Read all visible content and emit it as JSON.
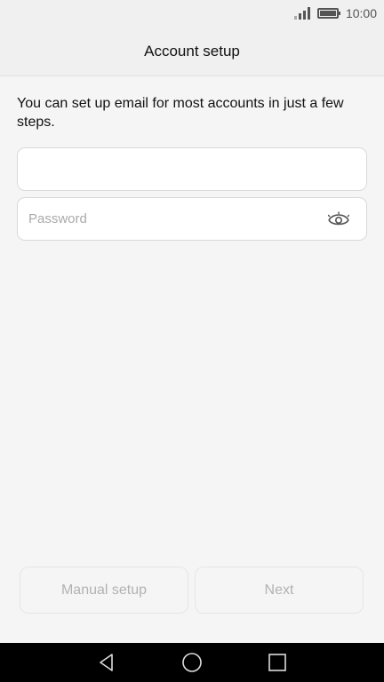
{
  "status_bar": {
    "time": "10:00",
    "icons": [
      "signal-icon",
      "battery-icon"
    ]
  },
  "header": {
    "title": "Account setup"
  },
  "intro_text": "You can set up email for most accounts in just a few steps.",
  "form": {
    "email": {
      "value": "",
      "placeholder": ""
    },
    "password": {
      "value": "",
      "placeholder": "Password"
    },
    "visibility_icon": "eye-icon"
  },
  "buttons": {
    "manual_setup": "Manual setup",
    "next": "Next"
  },
  "nav_bar": {
    "icons": [
      "back-icon",
      "home-icon",
      "recents-icon"
    ]
  },
  "colors": {
    "background": "#f5f5f5",
    "disabled_text": "#b2b2b2",
    "nav_bar": "#000000"
  }
}
